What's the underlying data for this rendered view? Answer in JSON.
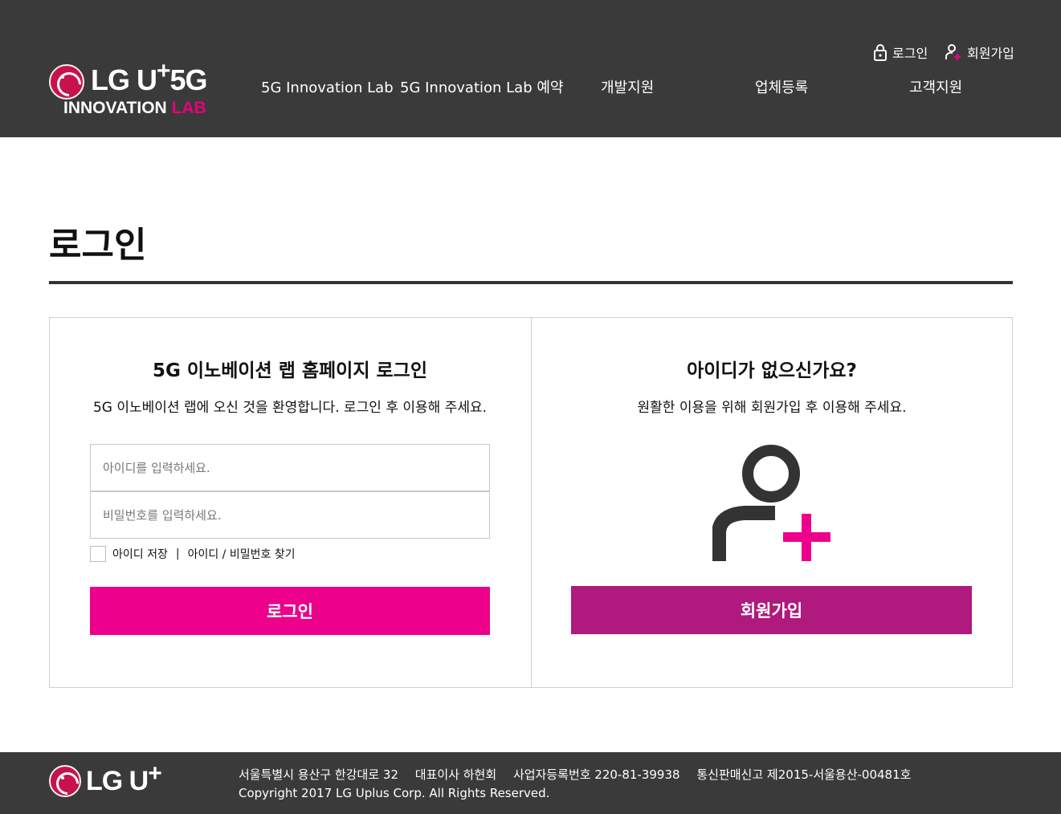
{
  "header": {
    "logo": {
      "brand": "LG U",
      "plus": "+",
      "tier": "5G",
      "sub_innovation": "INNOVATION",
      "sub_lab": "LAB"
    },
    "nav": [
      "5G Innovation Lab",
      "5G Innovation Lab 예약",
      "개발지원",
      "업체등록",
      "고객지원"
    ],
    "util": {
      "login": "로그인",
      "join": "회원가입"
    }
  },
  "page": {
    "title": "로그인"
  },
  "login_panel": {
    "heading": "5G 이노베이션 랩 홈페이지 로그인",
    "desc": "5G 이노베이션 랩에 오신 것을 환영합니다. 로그인 후 이용해 주세요.",
    "id_placeholder": "아이디를 입력하세요.",
    "pw_placeholder": "비밀번호를 입력하세요.",
    "remember_label": "아이디 저장",
    "separator": "|",
    "find_link": "아이디 / 비밀번호 찾기",
    "button": "로그인"
  },
  "join_panel": {
    "heading": "아이디가 없으신가요?",
    "desc": "원활한 이용을 위해 회원가입 후 이용해 주세요.",
    "icon": "user-add-icon",
    "button": "회원가입"
  },
  "footer": {
    "logo": {
      "brand": "LG U",
      "plus": "+"
    },
    "address": "서울특별시 용산구 한강대로 32",
    "ceo": "대표이사 하현회",
    "biz_no": "사업자등록번호 220-81-39938",
    "mail_order": "통신판매신고 제2015-서울용산-00481호",
    "copyright": "Copyright 2017 LG Uplus Corp. All Rights Reserved."
  },
  "colors": {
    "header_bg": "#3a3a3a",
    "accent_pink": "#ec008c",
    "accent_purple": "#b0197e",
    "lg_red": "#c8124b"
  }
}
